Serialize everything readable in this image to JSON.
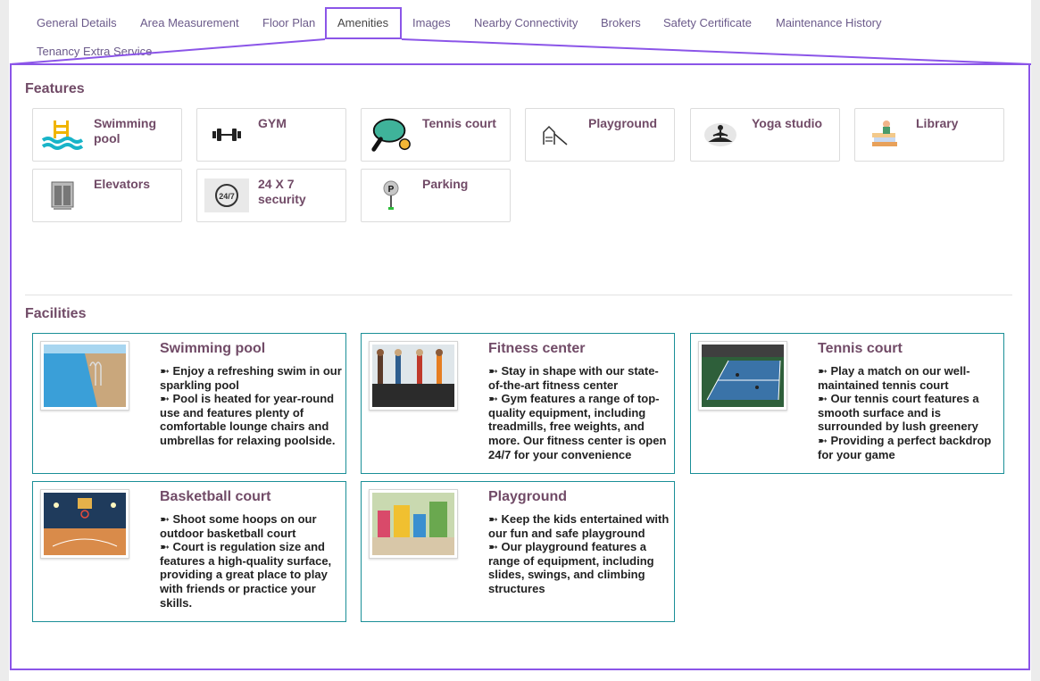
{
  "tabs": [
    {
      "label": "General Details"
    },
    {
      "label": "Area Measurement"
    },
    {
      "label": "Floor Plan"
    },
    {
      "label": "Amenities"
    },
    {
      "label": "Images"
    },
    {
      "label": "Nearby Connectivity"
    },
    {
      "label": "Brokers"
    },
    {
      "label": "Safety Certificate"
    },
    {
      "label": "Maintenance History"
    },
    {
      "label": "Tenancy Extra Service"
    }
  ],
  "active_tab": "Amenities",
  "colors": {
    "accent": "#8b55e8",
    "title": "#714b67",
    "facility_border": "#1a8f97"
  },
  "features": {
    "title": "Features",
    "items": [
      {
        "label": "Swimming pool",
        "icon": "swimming-pool-icon"
      },
      {
        "label": "GYM",
        "icon": "dumbbell-icon"
      },
      {
        "label": "Tennis court",
        "icon": "table-tennis-icon"
      },
      {
        "label": "Playground",
        "icon": "playground-icon"
      },
      {
        "label": "Yoga studio",
        "icon": "yoga-icon"
      },
      {
        "label": "Library",
        "icon": "library-icon"
      },
      {
        "label": "Elevators",
        "icon": "elevator-icon"
      },
      {
        "label": "24 X 7 security",
        "icon": "security-24-7-icon"
      },
      {
        "label": "Parking",
        "icon": "parking-icon"
      }
    ]
  },
  "facilities": {
    "title": "Facilities",
    "items": [
      {
        "title": "Swimming pool",
        "image": "pool-photo",
        "lines": [
          "➼ Enjoy a refreshing swim in our sparkling pool",
          "➼ Pool is heated for year-round use and features plenty of comfortable lounge chairs and umbrellas for relaxing poolside."
        ]
      },
      {
        "title": "Fitness center",
        "image": "gym-photo",
        "lines": [
          "➼ Stay in shape with our state-of-the-art fitness center",
          "➼ Gym features a range of top-quality equipment, including treadmills, free weights, and more. Our fitness center is open 24/7 for your convenience"
        ]
      },
      {
        "title": "Tennis court",
        "image": "tennis-photo",
        "lines": [
          "➼ Play a match on our well-maintained tennis court",
          "➼ Our tennis court features a smooth surface and is surrounded by lush greenery",
          "➼ Providing a perfect backdrop for your game"
        ]
      },
      {
        "title": "Basketball court",
        "image": "basketball-photo",
        "lines": [
          "➼ Shoot some hoops on our outdoor basketball court",
          "➼ Court is regulation size and features a high-quality surface, providing a great place to play with friends or practice your skills."
        ]
      },
      {
        "title": "Playground",
        "image": "playground-photo",
        "lines": [
          "➼ Keep the kids entertained with our fun and safe playground",
          "➼ Our playground features a range of equipment, including slides, swings, and climbing structures"
        ]
      }
    ]
  }
}
